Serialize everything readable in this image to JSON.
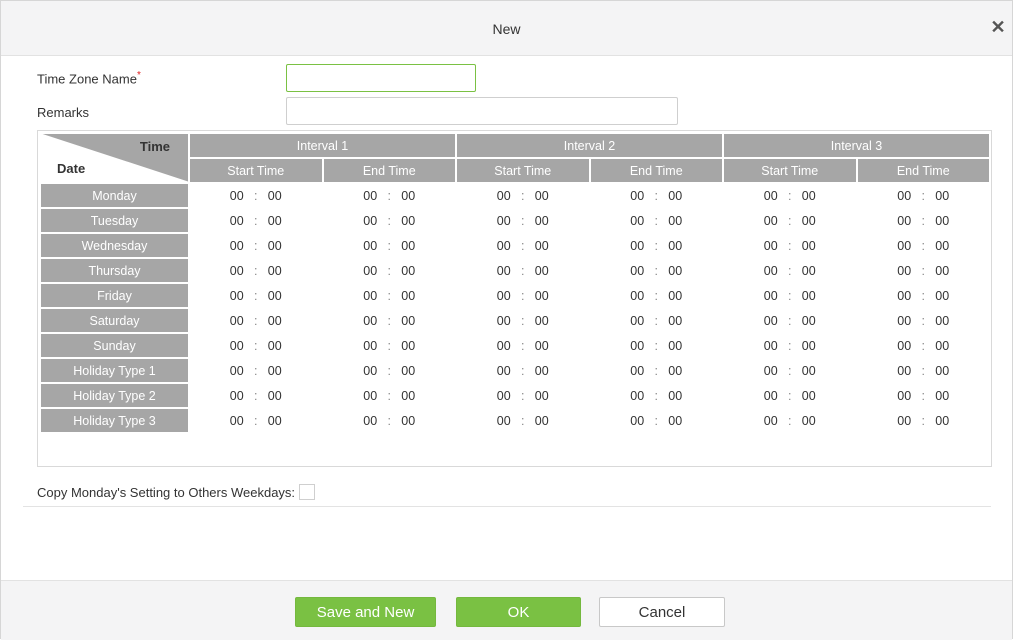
{
  "dialog": {
    "title": "New",
    "close_icon": "close-icon"
  },
  "form": {
    "name_label": "Time Zone Name",
    "name_required_marker": "*",
    "name_value": "",
    "remarks_label": "Remarks",
    "remarks_value": ""
  },
  "grid": {
    "corner_time": "Time",
    "corner_date": "Date",
    "intervals": [
      "Interval 1",
      "Interval 2",
      "Interval 3"
    ],
    "start_label": "Start Time",
    "end_label": "End Time",
    "separator": ":",
    "days": [
      "Monday",
      "Tuesday",
      "Wednesday",
      "Thursday",
      "Friday",
      "Saturday",
      "Sunday",
      "Holiday Type 1",
      "Holiday Type 2",
      "Holiday Type 3"
    ],
    "hour_value": "00",
    "minute_value": "00"
  },
  "copy": {
    "label": "Copy Monday's Setting to Others Weekdays:",
    "checked": false
  },
  "buttons": {
    "save_new": "Save and New",
    "ok": "OK",
    "cancel": "Cancel"
  },
  "colors": {
    "accent_green": "#7ac143",
    "header_grey": "#a6a6a6"
  }
}
